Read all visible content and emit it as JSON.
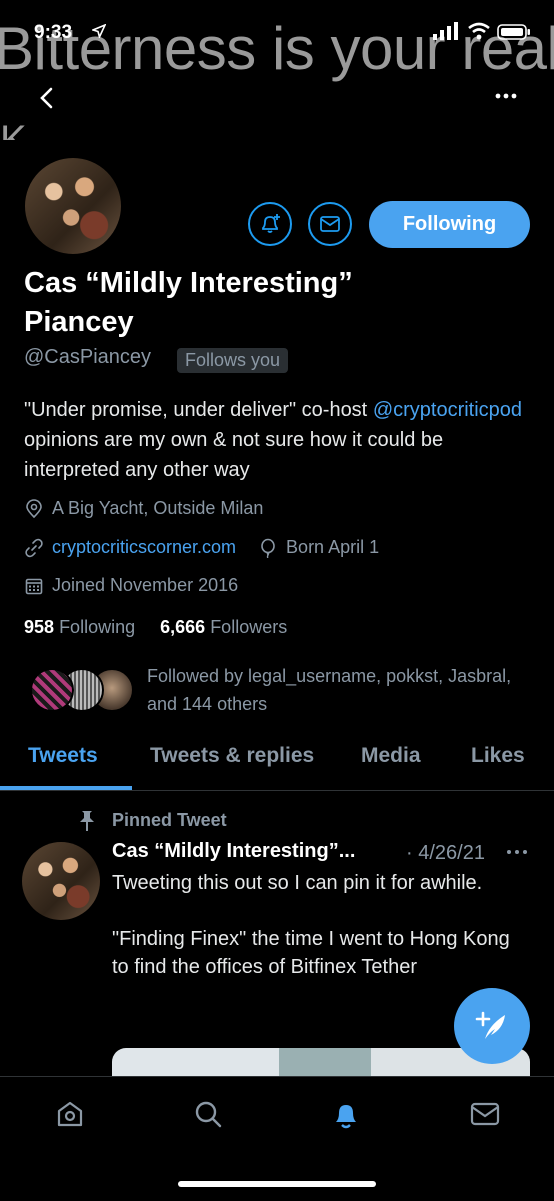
{
  "status_bar": {
    "time": "9:33"
  },
  "banner": {
    "text": "Bitterness is your reality",
    "fragment": "K."
  },
  "profile": {
    "name": "Cas “Mildly Interesting” Piancey",
    "handle": "@CasPiancey",
    "follows_you": "Follows you",
    "follow_button": "Following",
    "bio_prefix": "\"Under promise, under deliver\" co-host ",
    "bio_link": "@cryptocriticpod",
    "bio_suffix": " opinions are my own & not sure how it could be interpreted any other way",
    "location": "A Big Yacht, Outside Milan",
    "website": "cryptocriticscorner.com",
    "birthday": "Born April 1",
    "joined": "Joined November 2016",
    "following_count": "958",
    "following_label": "Following",
    "followers_count": "6,666",
    "followers_label": "Followers",
    "followed_by": "Followed by legal_username, pokkst, Jasbral, and 144 others"
  },
  "tabs": [
    {
      "label": "Tweets",
      "active": true
    },
    {
      "label": "Tweets & replies",
      "active": false
    },
    {
      "label": "Media",
      "active": false
    },
    {
      "label": "Likes",
      "active": false
    }
  ],
  "tweet": {
    "pinned_label": "Pinned Tweet",
    "author": "Cas “Mildly Interesting”...",
    "date": "· 4/26/21",
    "body": "Tweeting this out so I can pin it for awhile.\n\n\"Finding Finex\" the time I went to Hong Kong to find the offices of Bitfinex Tether"
  },
  "colors": {
    "accent": "#4aa3f0",
    "background": "#000000",
    "muted": "#8b98a5"
  },
  "icons": [
    "back-icon",
    "more-icon",
    "bell-plus-icon",
    "mail-icon",
    "location-icon",
    "link-icon",
    "balloon-icon",
    "calendar-icon",
    "pin-icon",
    "compose-icon",
    "home-icon",
    "search-icon",
    "notifications-icon",
    "messages-icon"
  ]
}
